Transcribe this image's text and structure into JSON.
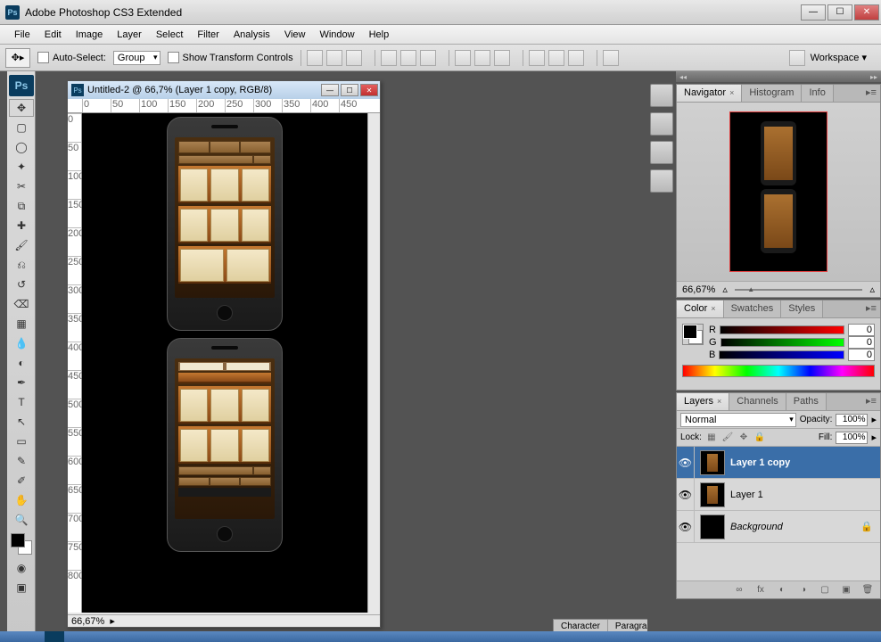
{
  "app": {
    "title": "Adobe Photoshop CS3 Extended"
  },
  "menu": [
    "File",
    "Edit",
    "Image",
    "Layer",
    "Select",
    "Filter",
    "Analysis",
    "View",
    "Window",
    "Help"
  ],
  "options": {
    "auto_select": "Auto-Select:",
    "group": "Group",
    "show_transform": "Show Transform Controls",
    "workspace": "Workspace"
  },
  "document": {
    "title": "Untitled-2 @ 66,7% (Layer 1 copy, RGB/8)",
    "status_zoom": "66,67%",
    "ruler_h": [
      "0",
      "50",
      "100",
      "150",
      "200",
      "250",
      "300",
      "350",
      "400",
      "450"
    ],
    "ruler_v": [
      "0",
      "50",
      "100",
      "150",
      "200",
      "250",
      "300",
      "350",
      "400",
      "450",
      "500",
      "550",
      "600",
      "650",
      "700",
      "750",
      "800"
    ]
  },
  "panels": {
    "navigator": {
      "tabs": [
        "Navigator",
        "Histogram",
        "Info"
      ],
      "zoom": "66,67%"
    },
    "color": {
      "tabs": [
        "Color",
        "Swatches",
        "Styles"
      ],
      "r_label": "R",
      "r_val": "0",
      "g_label": "G",
      "g_val": "0",
      "b_label": "B",
      "b_val": "0"
    },
    "layers": {
      "tabs": [
        "Layers",
        "Channels",
        "Paths"
      ],
      "blend": "Normal",
      "opacity_label": "Opacity:",
      "opacity": "100%",
      "lock_label": "Lock:",
      "fill_label": "Fill:",
      "fill": "100%",
      "items": [
        {
          "name": "Layer 1 copy",
          "visible": true,
          "selected": true,
          "locked": false,
          "italic": false
        },
        {
          "name": "Layer 1",
          "visible": true,
          "selected": false,
          "locked": false,
          "italic": false
        },
        {
          "name": "Background",
          "visible": true,
          "selected": false,
          "locked": true,
          "italic": true
        }
      ]
    },
    "character": {
      "tabs": [
        "Character",
        "Paragraph"
      ]
    }
  }
}
